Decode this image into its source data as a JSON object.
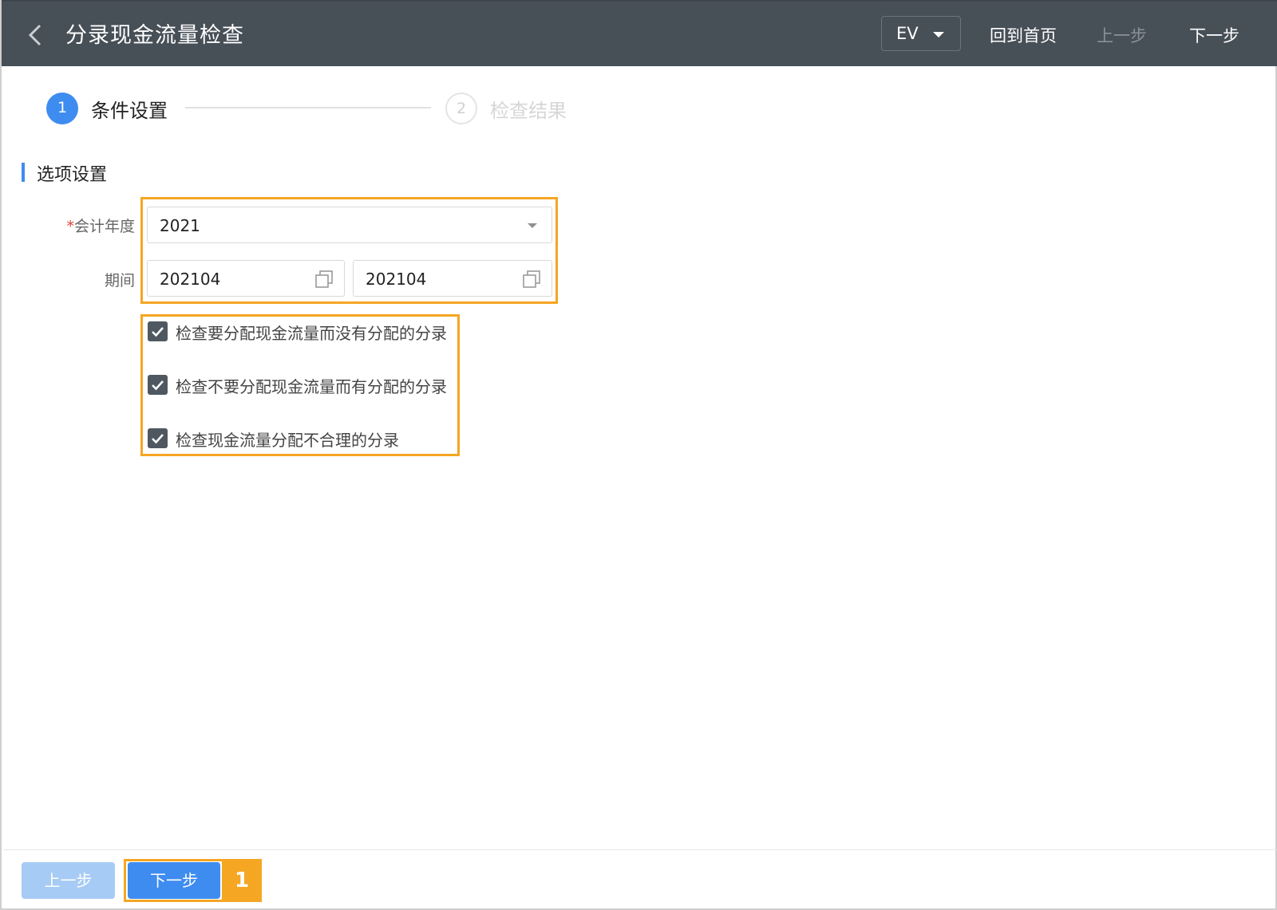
{
  "header": {
    "title": "分录现金流量检查",
    "ev_select": "EV",
    "links": {
      "home": "回到首页",
      "prev": "上一步",
      "next": "下一步"
    }
  },
  "steps": [
    {
      "number": "1",
      "label": "条件设置",
      "state": "active"
    },
    {
      "number": "2",
      "label": "检查结果",
      "state": "pending"
    }
  ],
  "section": {
    "title": "选项设置"
  },
  "form": {
    "fiscal_year": {
      "required_mark": "*",
      "label": "会计年度",
      "value": "2021"
    },
    "period": {
      "label": "期间",
      "start": "202104",
      "end": "202104"
    }
  },
  "checks": [
    {
      "label": "检查要分配现金流量而没有分配的分录",
      "checked": true
    },
    {
      "label": "检查不要分配现金流量而有分配的分录",
      "checked": true
    },
    {
      "label": "检查现金流量分配不合理的分录",
      "checked": true
    }
  ],
  "footer": {
    "prev_label": "上一步",
    "next_label": "下一步",
    "callout_number": "1"
  },
  "colors": {
    "header_bg": "#474f57",
    "accent": "#3e8cf0",
    "highlight": "#f5a623",
    "disabled_button": "#a6cbf5"
  }
}
